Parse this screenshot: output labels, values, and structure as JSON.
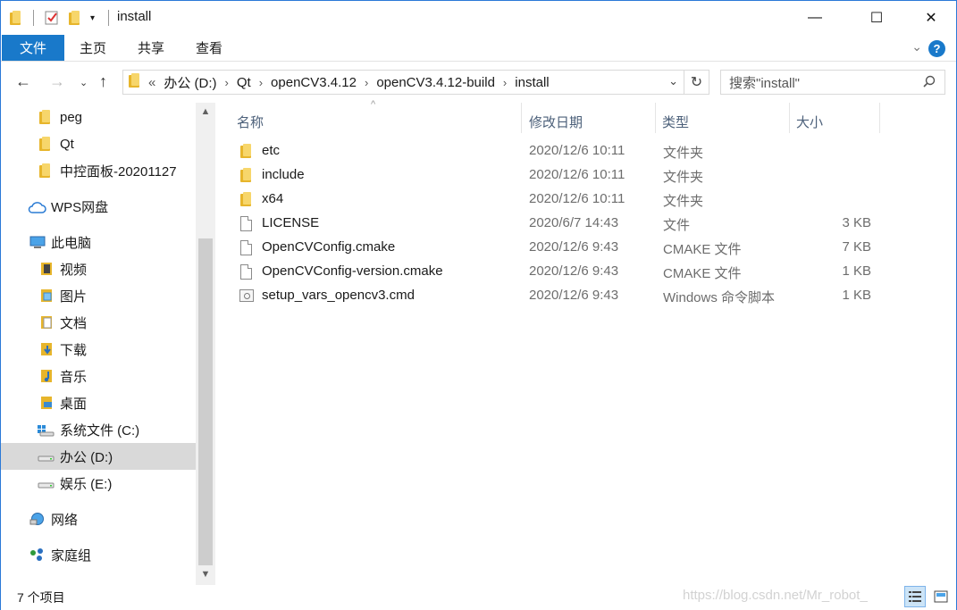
{
  "window": {
    "title": "install",
    "minimize_glyph": "—",
    "maximize_glyph": "☐",
    "close_glyph": "✕"
  },
  "ribbon": {
    "tabs": [
      "文件",
      "主页",
      "共享",
      "查看"
    ],
    "help_label": "?",
    "expand_glyph": "⌄",
    "accent": "#1979ca"
  },
  "address": {
    "overflow": "«",
    "crumbs": [
      "办公 (D:)",
      "Qt",
      "openCV3.4.12",
      "openCV3.4.12-build",
      "install"
    ],
    "search_placeholder": "搜索\"install\""
  },
  "sidebar": {
    "items": [
      {
        "label": "peg",
        "icon": "folder-icon"
      },
      {
        "label": "Qt",
        "icon": "folder-icon"
      },
      {
        "label": "中控面板-20201127",
        "icon": "folder-icon"
      },
      {
        "label": "WPS网盘",
        "icon": "cloud-icon"
      },
      {
        "label": "此电脑",
        "icon": "computer-icon"
      },
      {
        "label": "视频",
        "icon": "video-folder-icon"
      },
      {
        "label": "图片",
        "icon": "picture-folder-icon"
      },
      {
        "label": "文档",
        "icon": "document-folder-icon"
      },
      {
        "label": "下载",
        "icon": "download-folder-icon"
      },
      {
        "label": "音乐",
        "icon": "music-folder-icon"
      },
      {
        "label": "桌面",
        "icon": "desktop-folder-icon"
      },
      {
        "label": "系统文件 (C:)",
        "icon": "system-drive-icon"
      },
      {
        "label": "办公 (D:)",
        "icon": "drive-icon",
        "selected": true
      },
      {
        "label": "娱乐 (E:)",
        "icon": "drive-icon"
      },
      {
        "label": "网络",
        "icon": "network-icon"
      },
      {
        "label": "家庭组",
        "icon": "homegroup-icon"
      }
    ]
  },
  "columns": {
    "name": "名称",
    "date": "修改日期",
    "type": "类型",
    "size": "大小"
  },
  "files": [
    {
      "name": "etc",
      "date": "2020/12/6 10:11",
      "type": "文件夹",
      "size": "",
      "icon": "folder-icon"
    },
    {
      "name": "include",
      "date": "2020/12/6 10:11",
      "type": "文件夹",
      "size": "",
      "icon": "folder-icon"
    },
    {
      "name": "x64",
      "date": "2020/12/6 10:11",
      "type": "文件夹",
      "size": "",
      "icon": "folder-icon"
    },
    {
      "name": "LICENSE",
      "date": "2020/6/7 14:43",
      "type": "文件",
      "size": "3 KB",
      "icon": "file-icon"
    },
    {
      "name": "OpenCVConfig.cmake",
      "date": "2020/12/6 9:43",
      "type": "CMAKE 文件",
      "size": "7 KB",
      "icon": "file-icon"
    },
    {
      "name": "OpenCVConfig-version.cmake",
      "date": "2020/12/6 9:43",
      "type": "CMAKE 文件",
      "size": "1 KB",
      "icon": "file-icon"
    },
    {
      "name": "setup_vars_opencv3.cmd",
      "date": "2020/12/6 9:43",
      "type": "Windows 命令脚本",
      "size": "1 KB",
      "icon": "cmd-file-icon"
    }
  ],
  "status": {
    "count": "7 个项目",
    "watermark": "https://blog.csdn.net/Mr_robot_"
  }
}
